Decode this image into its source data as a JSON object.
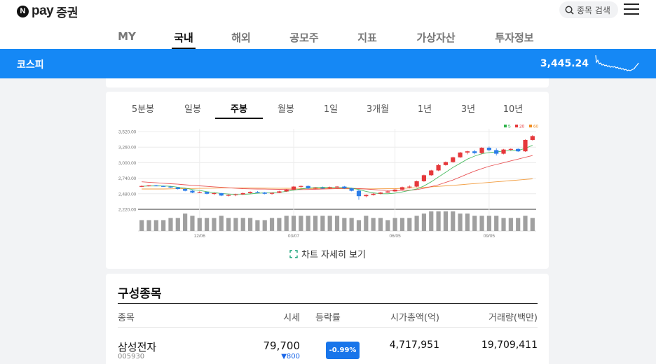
{
  "brand": {
    "logo_letter": "N",
    "logo_pay": "pay",
    "logo_securities": "증권"
  },
  "header": {
    "search_label": "종목 검색"
  },
  "nav": {
    "items": [
      "MY",
      "국내",
      "해외",
      "공모주",
      "지표",
      "가상자산",
      "투자정보"
    ],
    "active": "국내"
  },
  "index_bar": {
    "name": "코스피",
    "value": "3,445.24"
  },
  "period_tabs": {
    "items": [
      "5분봉",
      "일봉",
      "주봉",
      "월봉",
      "1일",
      "3개월",
      "1년",
      "3년",
      "10년"
    ],
    "active": "주봉"
  },
  "chart_data": {
    "type": "candlestick",
    "y_ticks": [
      "3,520.00",
      "3,260.00",
      "3,000.00",
      "2,740.00",
      "2,480.00",
      "2,220.00"
    ],
    "ylim": [
      2220,
      3520
    ],
    "x_ticks": [
      "12/06",
      "03/07",
      "06/05",
      "09/05"
    ],
    "legend": [
      "5",
      "20",
      "60"
    ],
    "colors": {
      "up": "#e5383b",
      "down": "#2b7de9",
      "ma5": "#2fb24a",
      "ma20": "#e5383b",
      "ma60": "#f08c1e",
      "volume": "#a0a0a0"
    },
    "candles_ohlc": [
      [
        2600,
        2620,
        2590,
        2610
      ],
      [
        2610,
        2625,
        2600,
        2620
      ],
      [
        2620,
        2630,
        2605,
        2610
      ],
      [
        2610,
        2615,
        2595,
        2600
      ],
      [
        2600,
        2605,
        2580,
        2585
      ],
      [
        2585,
        2590,
        2550,
        2560
      ],
      [
        2560,
        2570,
        2520,
        2530
      ],
      [
        2530,
        2540,
        2490,
        2500
      ],
      [
        2500,
        2520,
        2490,
        2510
      ],
      [
        2510,
        2515,
        2470,
        2480
      ],
      [
        2480,
        2500,
        2460,
        2490
      ],
      [
        2490,
        2495,
        2440,
        2450
      ],
      [
        2450,
        2470,
        2435,
        2460
      ],
      [
        2460,
        2480,
        2440,
        2470
      ],
      [
        2470,
        2500,
        2460,
        2490
      ],
      [
        2490,
        2520,
        2480,
        2510
      ],
      [
        2510,
        2525,
        2495,
        2500
      ],
      [
        2500,
        2510,
        2470,
        2480
      ],
      [
        2480,
        2500,
        2465,
        2495
      ],
      [
        2495,
        2530,
        2490,
        2520
      ],
      [
        2520,
        2560,
        2510,
        2550
      ],
      [
        2550,
        2610,
        2540,
        2600
      ],
      [
        2600,
        2620,
        2580,
        2610
      ],
      [
        2610,
        2620,
        2560,
        2570
      ],
      [
        2570,
        2590,
        2555,
        2580
      ],
      [
        2580,
        2600,
        2565,
        2575
      ],
      [
        2575,
        2600,
        2560,
        2590
      ],
      [
        2590,
        2610,
        2580,
        2600
      ],
      [
        2600,
        2610,
        2560,
        2570
      ],
      [
        2570,
        2580,
        2520,
        2530
      ],
      [
        2530,
        2550,
        2380,
        2440
      ],
      [
        2440,
        2470,
        2420,
        2460
      ],
      [
        2460,
        2490,
        2450,
        2480
      ],
      [
        2480,
        2510,
        2470,
        2500
      ],
      [
        2500,
        2530,
        2495,
        2520
      ],
      [
        2520,
        2560,
        2510,
        2550
      ],
      [
        2550,
        2600,
        2540,
        2590
      ],
      [
        2590,
        2620,
        2570,
        2600
      ],
      [
        2600,
        2700,
        2590,
        2690
      ],
      [
        2690,
        2800,
        2680,
        2790
      ],
      [
        2790,
        2880,
        2780,
        2870
      ],
      [
        2870,
        2980,
        2860,
        2960
      ],
      [
        2960,
        3020,
        2950,
        3010
      ],
      [
        3010,
        3100,
        3000,
        3090
      ],
      [
        3090,
        3180,
        3080,
        3170
      ],
      [
        3170,
        3200,
        3140,
        3190
      ],
      [
        3190,
        3215,
        3140,
        3160
      ],
      [
        3160,
        3260,
        3140,
        3250
      ],
      [
        3250,
        3270,
        3190,
        3210
      ],
      [
        3210,
        3240,
        3120,
        3150
      ],
      [
        3150,
        3230,
        3140,
        3220
      ],
      [
        3220,
        3240,
        3200,
        3230
      ],
      [
        3230,
        3240,
        3180,
        3190
      ],
      [
        3190,
        3390,
        3180,
        3380
      ],
      [
        3380,
        3460,
        3370,
        3445
      ]
    ],
    "ma5": [
      2605,
      2610,
      2612,
      2610,
      2605,
      2590,
      2575,
      2550,
      2535,
      2515,
      2500,
      2485,
      2475,
      2468,
      2470,
      2478,
      2488,
      2495,
      2498,
      2505,
      2520,
      2540,
      2560,
      2575,
      2585,
      2590,
      2588,
      2585,
      2588,
      2575,
      2550,
      2520,
      2495,
      2480,
      2480,
      2490,
      2510,
      2535,
      2560,
      2610,
      2680,
      2760,
      2840,
      2920,
      2990,
      3060,
      3110,
      3150,
      3170,
      3180,
      3195,
      3200,
      3205,
      3240,
      3290
    ],
    "ma20": [
      2680,
      2672,
      2664,
      2656,
      2648,
      2640,
      2630,
      2620,
      2612,
      2604,
      2596,
      2588,
      2580,
      2572,
      2566,
      2562,
      2560,
      2558,
      2556,
      2554,
      2552,
      2550,
      2550,
      2552,
      2555,
      2558,
      2562,
      2566,
      2570,
      2570,
      2566,
      2560,
      2550,
      2540,
      2535,
      2532,
      2535,
      2540,
      2550,
      2570,
      2600,
      2630,
      2670,
      2710,
      2760,
      2810,
      2860,
      2900,
      2940,
      2970,
      3000,
      3030,
      3060,
      3090,
      3120
    ],
    "ma60": [
      2560,
      2560,
      2560,
      2560,
      2562,
      2564,
      2566,
      2568,
      2570,
      2572,
      2574,
      2576,
      2576,
      2576,
      2576,
      2576,
      2575,
      2574,
      2573,
      2572,
      2571,
      2570,
      2569,
      2568,
      2567,
      2566,
      2565,
      2564,
      2563,
      2562,
      2562,
      2562,
      2562,
      2563,
      2564,
      2566,
      2570,
      2575,
      2580,
      2588,
      2596,
      2604,
      2612,
      2620,
      2630,
      2640,
      2650,
      2660,
      2670,
      2680,
      2690,
      2700,
      2710,
      2720,
      2730
    ],
    "volume": [
      5,
      5,
      5,
      5,
      6,
      6,
      8,
      7,
      6,
      6,
      6,
      7,
      6,
      6,
      6,
      6,
      5,
      5,
      6,
      6,
      7,
      7,
      7,
      7,
      7,
      7,
      7,
      7,
      6,
      6,
      5,
      7,
      6,
      6,
      5,
      6,
      6,
      6,
      7,
      8,
      9,
      9,
      9,
      9,
      8,
      8,
      7,
      7,
      7,
      7,
      6,
      6,
      6,
      7,
      6
    ]
  },
  "chart_detail_link": "차트 자세히 보기",
  "constituents": {
    "title": "구성종목",
    "columns": [
      "종목",
      "시세",
      "등락률",
      "시가총액(억)",
      "거래량(백만)"
    ],
    "rows": [
      {
        "name": "삼성전자",
        "code": "005930",
        "price": "79,700",
        "change": "▼800",
        "rate": "-0.99%",
        "market_cap": "4,717,951",
        "volume": "19,709,411"
      }
    ]
  }
}
